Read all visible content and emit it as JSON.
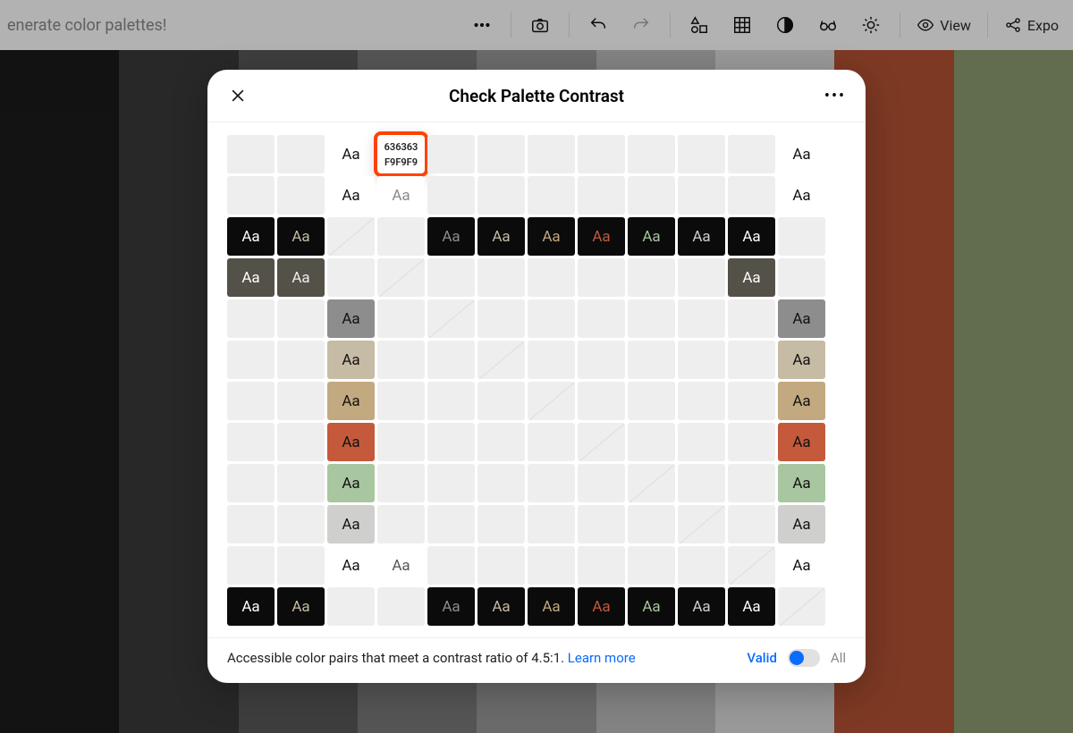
{
  "topbar": {
    "banner": "enerate color palettes!",
    "view_label": "View",
    "export_label": "Expo"
  },
  "palette_stripes": [
    "#1b1b1b",
    "#3a3a3a",
    "#5a5a5a",
    "#7a7a7a",
    "#9a9a9a",
    "#bcbcbc",
    "#dcdcdc",
    "#b35233",
    "#8b9c70"
  ],
  "modal": {
    "title": "Check Palette Contrast",
    "aa_label": "Aa",
    "tooltip": {
      "fg": "636363",
      "bg": "F9F9F9"
    },
    "footer_text": "Accessible color pairs that meet a contrast ratio of 4.5:1. ",
    "learn_more": "Learn more",
    "valid_label": "Valid",
    "all_label": "All"
  },
  "grid_colors": {
    "black": "#0b0b0b",
    "dkgray": "#545149",
    "midgray": "#8d8d8d",
    "beige1": "#c6bba4",
    "beige2": "#c3a97f",
    "orange": "#c45a3b",
    "green": "#a8c69f",
    "ltgray": "#cfd0cd",
    "white": "#ffffff"
  },
  "rows": [
    [
      {
        "t": "e"
      },
      {
        "t": "e"
      },
      {
        "t": "aa",
        "bg": "white",
        "fg": "#111"
      },
      {
        "t": "tip"
      },
      {
        "t": "e"
      },
      {
        "t": "e"
      },
      {
        "t": "e"
      },
      {
        "t": "e"
      },
      {
        "t": "e"
      },
      {
        "t": "e"
      },
      {
        "t": "e"
      },
      {
        "t": "aa",
        "bg": "white",
        "fg": "#111"
      }
    ],
    [
      {
        "t": "e"
      },
      {
        "t": "e"
      },
      {
        "t": "aa",
        "bg": "white",
        "fg": "#111"
      },
      {
        "t": "aa",
        "bg": "white",
        "fg": "#888"
      },
      {
        "t": "e"
      },
      {
        "t": "e"
      },
      {
        "t": "e"
      },
      {
        "t": "e"
      },
      {
        "t": "e"
      },
      {
        "t": "e"
      },
      {
        "t": "e"
      },
      {
        "t": "aa",
        "bg": "white",
        "fg": "#111"
      }
    ],
    [
      {
        "t": "aa",
        "bg": "black",
        "fg": "#fff"
      },
      {
        "t": "aa",
        "bg": "black",
        "fg": "#c6bba4"
      },
      {
        "t": "d"
      },
      {
        "t": "e"
      },
      {
        "t": "aa",
        "bg": "black",
        "fg": "#8d8d8d"
      },
      {
        "t": "aa",
        "bg": "black",
        "fg": "#c6bba4"
      },
      {
        "t": "aa",
        "bg": "black",
        "fg": "#c3a97f"
      },
      {
        "t": "aa",
        "bg": "black",
        "fg": "#c45a3b"
      },
      {
        "t": "aa",
        "bg": "black",
        "fg": "#a8c69f"
      },
      {
        "t": "aa",
        "bg": "black",
        "fg": "#cfd0cd"
      },
      {
        "t": "aa",
        "bg": "black",
        "fg": "#fff"
      },
      {
        "t": "e"
      }
    ],
    [
      {
        "t": "aa",
        "bg": "dkgray",
        "fg": "#fff"
      },
      {
        "t": "aa",
        "bg": "dkgray",
        "fg": "#eee"
      },
      {
        "t": "e"
      },
      {
        "t": "d"
      },
      {
        "t": "e"
      },
      {
        "t": "e"
      },
      {
        "t": "e"
      },
      {
        "t": "e"
      },
      {
        "t": "e"
      },
      {
        "t": "e"
      },
      {
        "t": "aa",
        "bg": "dkgray",
        "fg": "#fff"
      },
      {
        "t": "e"
      }
    ],
    [
      {
        "t": "e"
      },
      {
        "t": "e"
      },
      {
        "t": "aa",
        "bg": "midgray",
        "fg": "#111"
      },
      {
        "t": "e"
      },
      {
        "t": "d"
      },
      {
        "t": "e"
      },
      {
        "t": "e"
      },
      {
        "t": "e"
      },
      {
        "t": "e"
      },
      {
        "t": "e"
      },
      {
        "t": "e"
      },
      {
        "t": "aa",
        "bg": "midgray",
        "fg": "#111"
      }
    ],
    [
      {
        "t": "e"
      },
      {
        "t": "e"
      },
      {
        "t": "aa",
        "bg": "beige1",
        "fg": "#111"
      },
      {
        "t": "e"
      },
      {
        "t": "e"
      },
      {
        "t": "d"
      },
      {
        "t": "e"
      },
      {
        "t": "e"
      },
      {
        "t": "e"
      },
      {
        "t": "e"
      },
      {
        "t": "e"
      },
      {
        "t": "aa",
        "bg": "beige1",
        "fg": "#111"
      }
    ],
    [
      {
        "t": "e"
      },
      {
        "t": "e"
      },
      {
        "t": "aa",
        "bg": "beige2",
        "fg": "#111"
      },
      {
        "t": "e"
      },
      {
        "t": "e"
      },
      {
        "t": "e"
      },
      {
        "t": "d"
      },
      {
        "t": "e"
      },
      {
        "t": "e"
      },
      {
        "t": "e"
      },
      {
        "t": "e"
      },
      {
        "t": "aa",
        "bg": "beige2",
        "fg": "#111"
      }
    ],
    [
      {
        "t": "e"
      },
      {
        "t": "e"
      },
      {
        "t": "aa",
        "bg": "orange",
        "fg": "#111"
      },
      {
        "t": "e"
      },
      {
        "t": "e"
      },
      {
        "t": "e"
      },
      {
        "t": "e"
      },
      {
        "t": "d"
      },
      {
        "t": "e"
      },
      {
        "t": "e"
      },
      {
        "t": "e"
      },
      {
        "t": "aa",
        "bg": "orange",
        "fg": "#111"
      }
    ],
    [
      {
        "t": "e"
      },
      {
        "t": "e"
      },
      {
        "t": "aa",
        "bg": "green",
        "fg": "#111"
      },
      {
        "t": "e"
      },
      {
        "t": "e"
      },
      {
        "t": "e"
      },
      {
        "t": "e"
      },
      {
        "t": "e"
      },
      {
        "t": "d"
      },
      {
        "t": "e"
      },
      {
        "t": "e"
      },
      {
        "t": "aa",
        "bg": "green",
        "fg": "#111"
      }
    ],
    [
      {
        "t": "e"
      },
      {
        "t": "e"
      },
      {
        "t": "aa",
        "bg": "ltgray",
        "fg": "#111"
      },
      {
        "t": "e"
      },
      {
        "t": "e"
      },
      {
        "t": "e"
      },
      {
        "t": "e"
      },
      {
        "t": "e"
      },
      {
        "t": "e"
      },
      {
        "t": "d"
      },
      {
        "t": "e"
      },
      {
        "t": "aa",
        "bg": "ltgray",
        "fg": "#111"
      }
    ],
    [
      {
        "t": "e"
      },
      {
        "t": "e"
      },
      {
        "t": "aa",
        "bg": "white",
        "fg": "#111"
      },
      {
        "t": "aa",
        "bg": "white",
        "fg": "#555"
      },
      {
        "t": "e"
      },
      {
        "t": "e"
      },
      {
        "t": "e"
      },
      {
        "t": "e"
      },
      {
        "t": "e"
      },
      {
        "t": "e"
      },
      {
        "t": "d"
      },
      {
        "t": "aa",
        "bg": "white",
        "fg": "#111"
      }
    ],
    [
      {
        "t": "aa",
        "bg": "black",
        "fg": "#fff"
      },
      {
        "t": "aa",
        "bg": "black",
        "fg": "#c6bba4"
      },
      {
        "t": "e"
      },
      {
        "t": "e"
      },
      {
        "t": "aa",
        "bg": "black",
        "fg": "#8d8d8d"
      },
      {
        "t": "aa",
        "bg": "black",
        "fg": "#c6bba4"
      },
      {
        "t": "aa",
        "bg": "black",
        "fg": "#c3a97f"
      },
      {
        "t": "aa",
        "bg": "black",
        "fg": "#c45a3b"
      },
      {
        "t": "aa",
        "bg": "black",
        "fg": "#a8c69f"
      },
      {
        "t": "aa",
        "bg": "black",
        "fg": "#cfd0cd"
      },
      {
        "t": "aa",
        "bg": "black",
        "fg": "#fff"
      },
      {
        "t": "d"
      }
    ]
  ]
}
